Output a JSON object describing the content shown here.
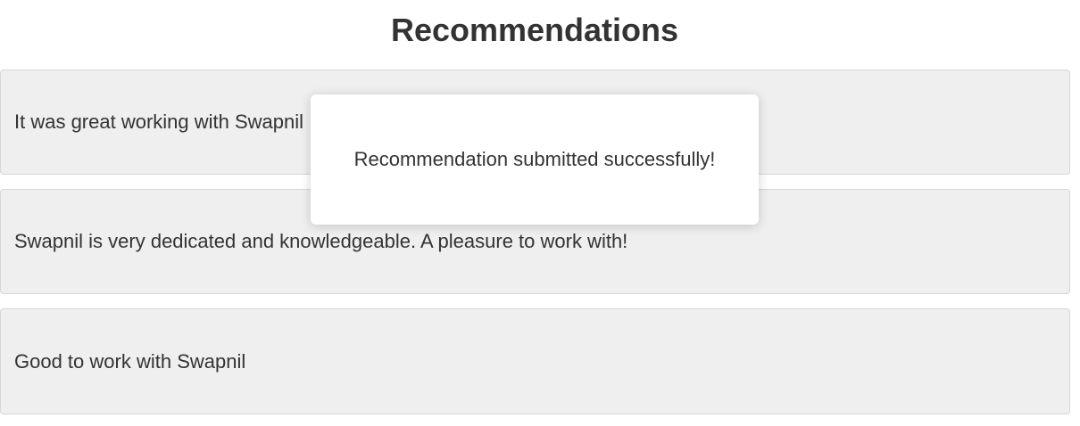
{
  "page": {
    "title": "Recommendations"
  },
  "recommendations": [
    {
      "text": "It was great working with Swapnil"
    },
    {
      "text": "Swapnil is very dedicated and knowledgeable. A pleasure to work with!"
    },
    {
      "text": "Good to work with Swapnil"
    }
  ],
  "toast": {
    "message": "Recommendation submitted successfully!"
  }
}
